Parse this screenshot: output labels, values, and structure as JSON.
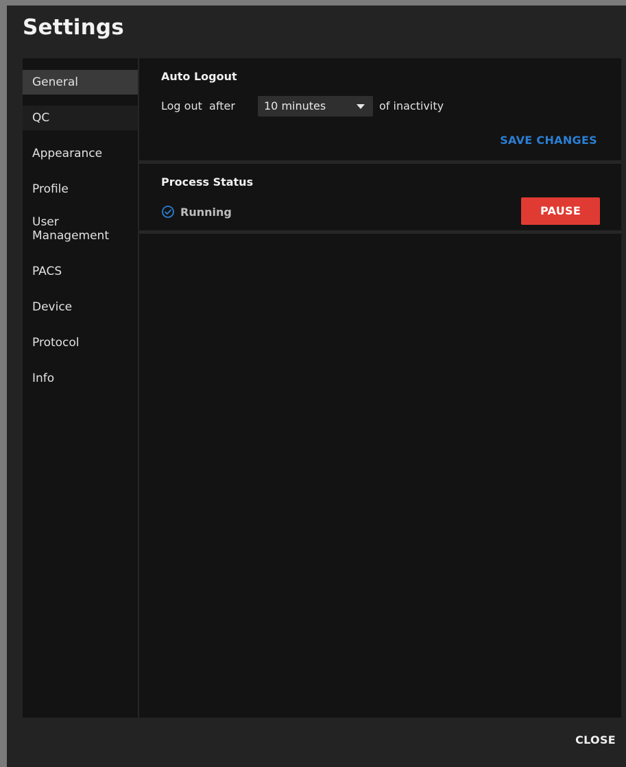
{
  "dialog": {
    "title": "Settings",
    "close_label": "CLOSE"
  },
  "sidebar": {
    "items": [
      {
        "label": "General",
        "state": "active"
      },
      {
        "label": "QC",
        "state": "hover"
      },
      {
        "label": "Appearance"
      },
      {
        "label": "Profile"
      },
      {
        "label_line1": "User",
        "label_line2": "Management"
      },
      {
        "label": "PACS"
      },
      {
        "label": "Device"
      },
      {
        "label": "Protocol"
      },
      {
        "label": "Info"
      }
    ]
  },
  "auto_logout": {
    "title": "Auto Logout",
    "prefix": "Log out  after",
    "selected": "10 minutes",
    "suffix": "of inactivity",
    "save_label": "SAVE CHANGES"
  },
  "process_status": {
    "title": "Process Status",
    "status": "Running",
    "status_icon": "check-circle-icon",
    "pause_label": "PAUSE"
  },
  "colors": {
    "accent_blue": "#2b7fd4",
    "danger_red": "#e03b33"
  }
}
